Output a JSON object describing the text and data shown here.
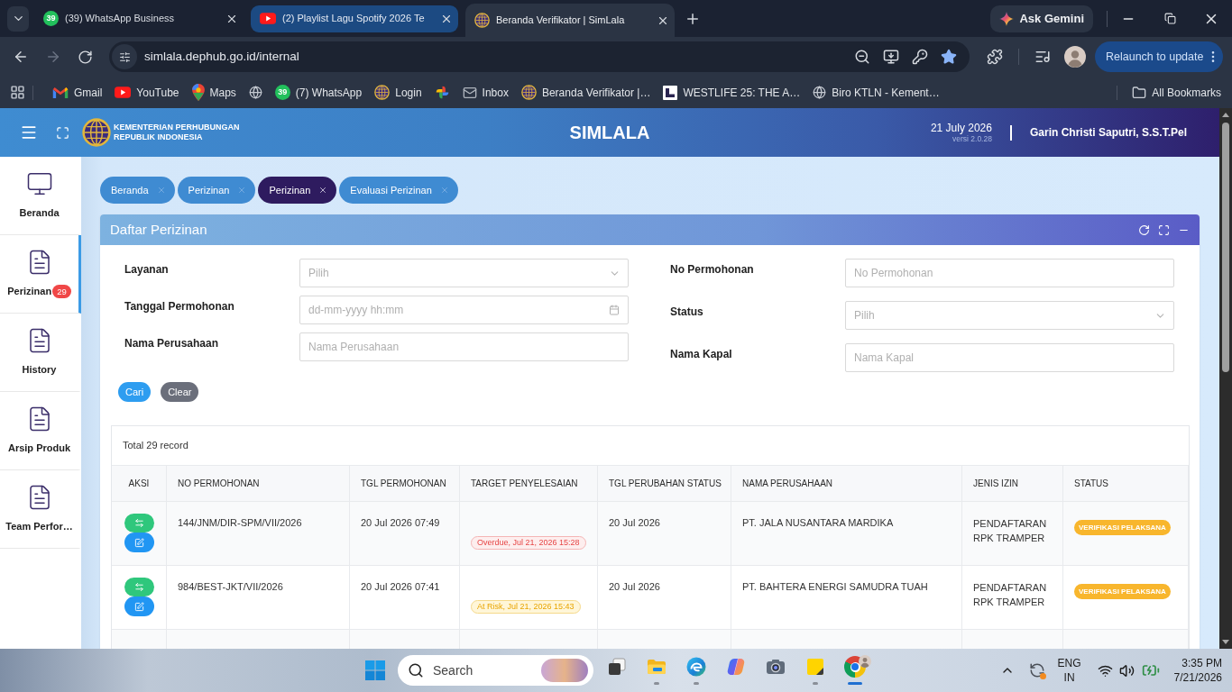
{
  "browser": {
    "tabs": [
      {
        "kind": "whatsapp",
        "badge": "39",
        "title": "(39) WhatsApp Business",
        "selected": false,
        "hovered": false
      },
      {
        "kind": "youtube",
        "title": "(2) Playlist Lagu Spotify 2026 Te",
        "selected": false,
        "hovered": true
      },
      {
        "kind": "simlala",
        "title": "Beranda Verifikator | SimLala",
        "selected": true,
        "hovered": false
      }
    ],
    "gemini": "Ask Gemini",
    "forward_disabled": true,
    "url": "simlala.dephub.go.id/internal",
    "starred": true,
    "relaunch": "Relaunch to update",
    "bookmarks": [
      {
        "kind": "gmail",
        "label": "Gmail"
      },
      {
        "kind": "youtube",
        "label": "YouTube"
      },
      {
        "kind": "maps",
        "label": "Maps"
      },
      {
        "kind": "globe"
      },
      {
        "kind": "whatsapp",
        "badge": "39",
        "label": "(7) WhatsApp"
      },
      {
        "kind": "simlala",
        "label": "Login"
      },
      {
        "kind": "photos"
      },
      {
        "kind": "mail",
        "label": "Inbox"
      },
      {
        "kind": "simlala",
        "label": "Beranda Verifikator |…"
      },
      {
        "kind": "square_logo",
        "label": "WESTLIFE 25: THE A…"
      },
      {
        "kind": "globe",
        "label": "Biro KTLN - Kement…"
      }
    ],
    "all_bookmarks": "All Bookmarks"
  },
  "header": {
    "org_lines": [
      "KEMENTERIAN PERHUBUNGAN",
      "REPUBLIK INDONESIA"
    ],
    "title": "SIMLALA",
    "date": "21 July 2026",
    "version": "versi 2.0.28",
    "user": "Garin Christi Saputri, S.S.T.Pel"
  },
  "sidebar": {
    "items": [
      {
        "kind": "monitor",
        "label": "Beranda",
        "selected": false
      },
      {
        "kind": "document",
        "label": "Perizinan",
        "badge": "29",
        "selected": true
      },
      {
        "kind": "document",
        "label": "History",
        "selected": false
      },
      {
        "kind": "document",
        "label": "Arsip Produk",
        "selected": false
      },
      {
        "kind": "document",
        "label": "Team Perfor…",
        "selected": false
      }
    ]
  },
  "page_tabs": [
    {
      "label": "Beranda",
      "selected": false
    },
    {
      "label": "Perizinan",
      "selected": false
    },
    {
      "label": "Perizinan",
      "selected": true
    },
    {
      "label": "Evaluasi Perizinan",
      "selected": false
    }
  ],
  "panel": {
    "title": "Daftar Perizinan",
    "filter_columns": [
      {
        "fields": [
          {
            "label": "Layanan",
            "kind": "select",
            "placeholder": "Pilih"
          },
          {
            "label": "Tanggal Permohonan",
            "kind": "date",
            "placeholder": "dd-mm-yyyy hh:mm"
          },
          {
            "label": "Nama Perusahaan",
            "kind": "text",
            "placeholder": "Nama Perusahaan"
          }
        ]
      },
      {
        "fields": [
          {
            "label": "No Permohonan",
            "kind": "text",
            "placeholder": "No Permohonan"
          },
          {
            "label": "Status",
            "kind": "select",
            "placeholder": "Pilih"
          },
          {
            "label": "Nama Kapal",
            "kind": "text",
            "placeholder": "Nama Kapal"
          }
        ]
      }
    ],
    "buttons": [
      {
        "label": "Cari",
        "kind": "search"
      },
      {
        "label": "Clear",
        "kind": "clear"
      }
    ],
    "table": {
      "total": "Total 29 record",
      "columns": [
        "AKSI",
        "NO PERMOHONAN",
        "TGL PERMOHONAN",
        "TARGET PENYELESAIAN",
        "TGL PERUBAHAN STATUS",
        "NAMA PERUSAHAAN",
        "JENIS IZIN",
        "STATUS"
      ],
      "rows": [
        {
          "no_permohonan": "144/JNM/DIR-SPM/VII/2026",
          "tgl_permohonan": "20 Jul 2026 07:49",
          "target": {
            "kind": "overdue",
            "text": "Overdue, Jul 21, 2026 15:28"
          },
          "tgl_perubahan_status": "20 Jul 2026",
          "nama_perusahaan": "PT. JALA NUSANTARA MARDIKA",
          "jenis_izin": "PENDAFTARAN RPK TRAMPER",
          "status": "VERIFIKASI PELAKSANA"
        },
        {
          "no_permohonan": "984/BEST-JKT/VII/2026",
          "tgl_permohonan": "20 Jul 2026 07:41",
          "target": {
            "kind": "at_risk",
            "text": "At Risk, Jul 21, 2026 15:43"
          },
          "tgl_perubahan_status": "20 Jul 2026",
          "nama_perusahaan": "PT. BAHTERA ENERGI SAMUDRA TUAH",
          "jenis_izin": "PENDAFTARAN RPK TRAMPER",
          "status": "VERIFIKASI PELAKSANA"
        }
      ]
    }
  },
  "taskbar": {
    "search": "Search",
    "apps": [
      {
        "kind": "task_view",
        "running": false,
        "active": false
      },
      {
        "kind": "explorer",
        "running": true,
        "active": false
      },
      {
        "kind": "edge",
        "running": true,
        "active": false
      },
      {
        "kind": "copilot",
        "running": false,
        "active": false
      },
      {
        "kind": "camera",
        "running": false,
        "active": false
      },
      {
        "kind": "sticky_notes",
        "running": true,
        "active": false
      },
      {
        "kind": "chrome",
        "running": true,
        "active": true
      }
    ],
    "language": [
      "ENG",
      "IN"
    ],
    "time": "3:35 PM",
    "date": "7/21/2026"
  }
}
